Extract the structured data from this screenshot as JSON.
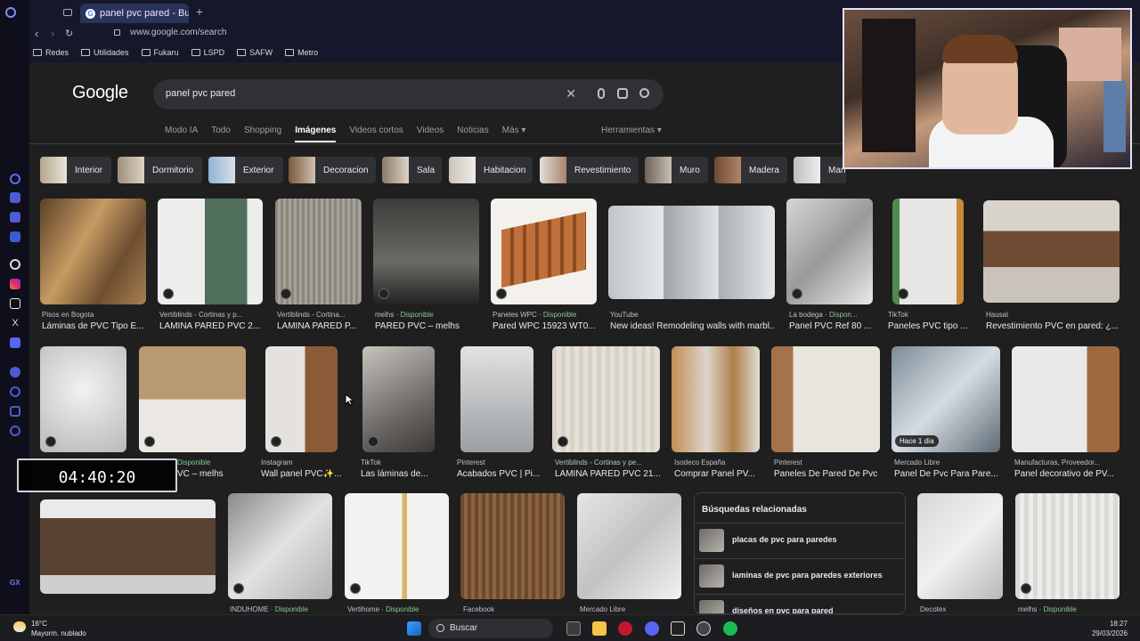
{
  "browser": {
    "tab_title": "panel pvc pared - Buscar c",
    "url": "www.google.com/search",
    "bookmarks": [
      "Redes",
      "Utilidades",
      "Fukaru",
      "LSPD",
      "SAFW",
      "Metro"
    ]
  },
  "google": {
    "logo": "Google",
    "query": "panel pvc pared",
    "tabs": [
      "Modo IA",
      "Todo",
      "Shopping",
      "Imágenes",
      "Videos cortos",
      "Videos",
      "Noticias",
      "Más ▾"
    ],
    "active_tab": "Imágenes",
    "tools_label": "Herramientas ▾"
  },
  "chips": [
    "Interior",
    "Dormitorio",
    "Exterior",
    "Decoracion",
    "Sala",
    "Habitacion",
    "Revestimiento",
    "Muro",
    "Madera",
    "Marmol"
  ],
  "row1": [
    {
      "source": "Pisos en Bogota",
      "available": "",
      "title": "Láminas de PVC Tipo E..."
    },
    {
      "source": "Vertiblinds - Cortinas y p...",
      "available": "",
      "title": "LAMINA PARED PVC 2..."
    },
    {
      "source": "Vertiblinds - Cortina...",
      "available": "",
      "title": "LAMINA PARED P..."
    },
    {
      "source": "melhs ·",
      "available": "Disponible",
      "title": "PARED PVC – melhs"
    },
    {
      "source": "Paneles WPC ·",
      "available": "Disponible",
      "title": "Pared WPC 15923 WT0..."
    },
    {
      "source": "YouTube",
      "available": "",
      "title": "New ideas! Remodeling walls with marbl..."
    },
    {
      "source": "La bodega ·",
      "available": "Dispon...",
      "title": "Panel PVC Ref 80 ..."
    },
    {
      "source": "TikTok",
      "available": "",
      "title": "Paneles PVC tipo ..."
    },
    {
      "source": "Hausal",
      "available": "",
      "title": "Revestimiento PVC en pared: ¿..."
    }
  ],
  "row2": [
    {
      "source": "",
      "available": "Disponible",
      "title": "VC – melhs"
    },
    {
      "source": "",
      "available": "",
      "title": ""
    },
    {
      "source": "Instagram",
      "available": "",
      "title": "Wall panel PVC✨..."
    },
    {
      "source": "TikTok",
      "available": "",
      "title": "Las láminas de..."
    },
    {
      "source": "Pinterest",
      "available": "",
      "title": "Acabados PVC | Pi..."
    },
    {
      "source": "Vertiblinds - Cortinas y pe...",
      "available": "",
      "title": "LAMINA PARED PVC 21..."
    },
    {
      "source": "Isodeco España",
      "available": "",
      "title": "Comprar Panel PV..."
    },
    {
      "source": "Pinterest",
      "available": "",
      "title": "Paneles De Pared De Pvc"
    },
    {
      "source": "Mercado Libre",
      "available": "",
      "title": "Panel De Pvc Para Pare..."
    },
    {
      "source": "Manufacturas, Proveedor...",
      "available": "",
      "title": "Panel decorativo de PV..."
    }
  ],
  "row2_badge": "Hace 1 día",
  "row3": [
    {
      "source": "",
      "available": ""
    },
    {
      "source": "INDUHOME ·",
      "available": "Disponible"
    },
    {
      "source": "Vertihome ·",
      "available": "Disponible"
    },
    {
      "source": "Facebook",
      "available": ""
    },
    {
      "source": "Mercado Libre",
      "available": ""
    },
    {
      "source": "Decotex",
      "available": ""
    },
    {
      "source": "melhs ·",
      "available": "Disponible"
    }
  ],
  "related": {
    "heading": "Búsquedas relacionadas",
    "items": [
      "placas de pvc para paredes",
      "laminas de pvc para paredes exteriores",
      "diseños en pvc para pared"
    ]
  },
  "timer": "04:40:20",
  "taskbar": {
    "temp": "16°C",
    "weather": "Mayorm. nublado",
    "search_label": "Buscar",
    "time": "18:27",
    "date": "29/03/2026"
  },
  "colors": {
    "accent_available": "#81c995",
    "page_bg": "#1f1f1f",
    "browser_chrome": "#16172a"
  }
}
